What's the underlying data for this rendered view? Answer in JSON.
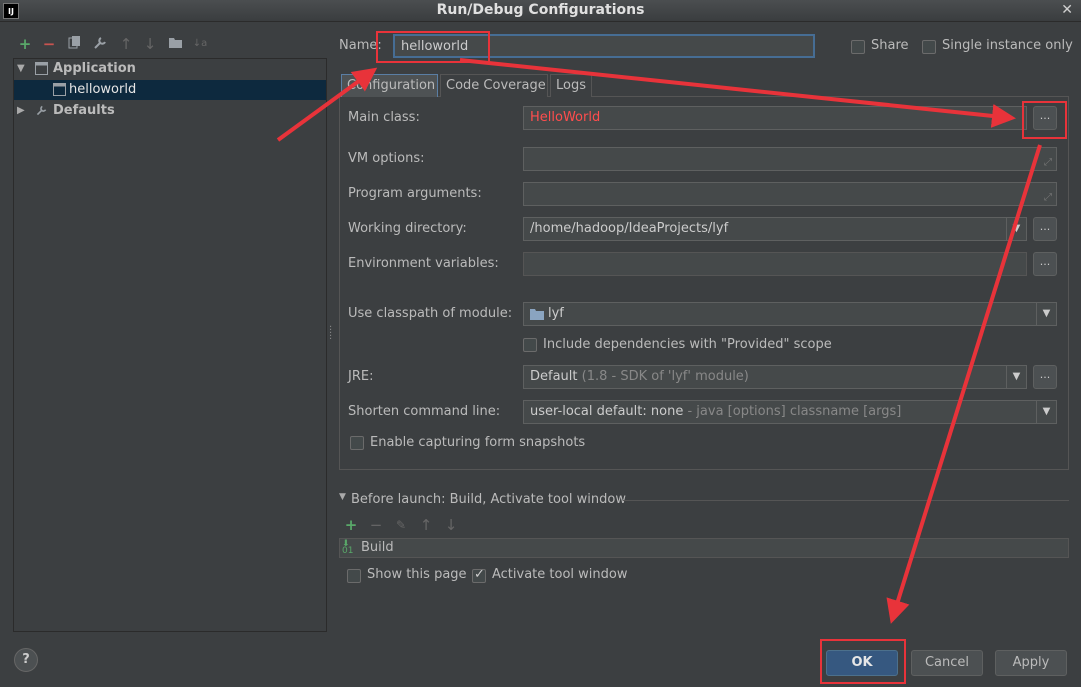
{
  "window": {
    "title": "Run/Debug Configurations",
    "logo": "IJ",
    "close_glyph": "✕"
  },
  "toolbar": {
    "icons": [
      "add-icon",
      "remove-icon",
      "copy-icon",
      "wrench-icon",
      "move-up-icon",
      "move-down-icon",
      "folder-icon",
      "sort-icon"
    ]
  },
  "tree": {
    "application_label": "Application",
    "helloworld_label": "helloworld",
    "defaults_label": "Defaults"
  },
  "name_field": {
    "label": "Name:",
    "value": "helloworld"
  },
  "share": {
    "label": "Share",
    "checked": false
  },
  "single_instance": {
    "label": "Single instance only",
    "checked": false
  },
  "tabs": [
    "Configuration",
    "Code Coverage",
    "Logs"
  ],
  "form": {
    "main_class": {
      "label": "Main class:",
      "value": "HelloWorld",
      "value_color": "#ff4d4d"
    },
    "vm_options": {
      "label": "VM options:",
      "value": ""
    },
    "program_arguments": {
      "label": "Program arguments:",
      "value": ""
    },
    "working_directory": {
      "label": "Working directory:",
      "value": "/home/hadoop/IdeaProjects/lyf"
    },
    "environment_variables": {
      "label": "Environment variables:",
      "value": ""
    },
    "classpath_module": {
      "label": "Use classpath of module:",
      "value": "lyf"
    },
    "include_provided": {
      "label": "Include dependencies with \"Provided\" scope",
      "checked": false
    },
    "jre": {
      "label": "JRE:",
      "value": "Default",
      "hint": "(1.8 - SDK of 'lyf' module)"
    },
    "shorten_command_line": {
      "label": "Shorten command line:",
      "value": "user-local default: none",
      "hint": "- java [options] classname [args]"
    },
    "enable_snapshots": {
      "label": "Enable capturing form snapshots",
      "checked": false
    }
  },
  "before_launch": {
    "title": "Before launch: Build, Activate tool window",
    "items": [
      "Build"
    ],
    "show_this_page": {
      "label": "Show this page",
      "checked": false
    },
    "activate_tool_window": {
      "label": "Activate tool window",
      "checked": true
    }
  },
  "buttons": {
    "ok": "OK",
    "cancel": "Cancel",
    "apply": "Apply",
    "browse": "...",
    "help": "?"
  },
  "colors": {
    "annotation": "#e8333a",
    "selection": "#0d293e",
    "primary_button": "#365880"
  }
}
